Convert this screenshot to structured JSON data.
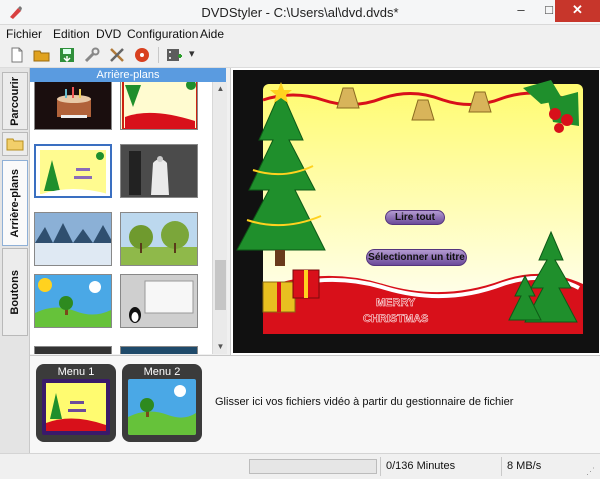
{
  "window": {
    "title": "DVDStyler - C:\\Users\\al\\dvd.dvds*",
    "minimize": "–",
    "maximize": "□",
    "close": "✕"
  },
  "menubar": {
    "items": [
      {
        "label": "Fichier",
        "id": "fichier"
      },
      {
        "label": "Edition",
        "id": "edition"
      },
      {
        "label": "DVD",
        "id": "dvd"
      },
      {
        "label": "Configuration",
        "id": "configuration"
      },
      {
        "label": "Aide",
        "id": "aide"
      }
    ]
  },
  "toolbar": {
    "buttons": [
      {
        "icon": "new-document-icon",
        "color": "#e8e8e8"
      },
      {
        "icon": "open-folder-icon",
        "color": "#e0a21f"
      },
      {
        "icon": "save-icon",
        "color": "#2f8f3b"
      },
      {
        "icon": "settings-wrench-icon",
        "color": "#9a9a9a"
      },
      {
        "icon": "tools-icon",
        "color": "#b07a3a"
      },
      {
        "icon": "burn-disc-icon",
        "color": "#d8401f"
      },
      {
        "icon": "add-film-icon",
        "color": "#5c5c5c"
      }
    ],
    "dropdown_arrow": "▾"
  },
  "sidebar": {
    "tabs": [
      {
        "label": "Parcourir",
        "active": false
      },
      {
        "label": "Arrière-plans",
        "active": true
      },
      {
        "label": "Boutons",
        "active": false
      }
    ]
  },
  "backgrounds_panel": {
    "header": "Arrière-plans",
    "thumbnails": [
      {
        "name": "birthday-cake",
        "selected": false
      },
      {
        "name": "christmas-frame-red",
        "selected": false
      },
      {
        "name": "christmas-tree-frame",
        "selected": true
      },
      {
        "name": "wedding-bw",
        "selected": false
      },
      {
        "name": "winter-forest",
        "selected": false
      },
      {
        "name": "park-trees",
        "selected": false
      },
      {
        "name": "cartoon-landscape",
        "selected": false
      },
      {
        "name": "penguin-screen",
        "selected": false
      }
    ]
  },
  "menu_preview": {
    "buttons": [
      {
        "label": "Lire tout"
      },
      {
        "label": "Sélectionner un titre"
      }
    ],
    "greeting_line1": "MERRY",
    "greeting_line2": "CHRISTMAS",
    "colors": {
      "bg_top": "#fffb70",
      "bg_bottom": "#ffffff",
      "border": "#111111",
      "ribbon": "#d8101a"
    }
  },
  "titles_panel": {
    "menus": [
      {
        "label": "Menu 1"
      },
      {
        "label": "Menu 2"
      }
    ],
    "drop_hint": "Glisser ici vos fichiers vidéo à partir du gestionnaire de fichier"
  },
  "status": {
    "progress_fraction": 0.0,
    "duration": "0/136 Minutes",
    "bitrate": "8 MB/s"
  }
}
